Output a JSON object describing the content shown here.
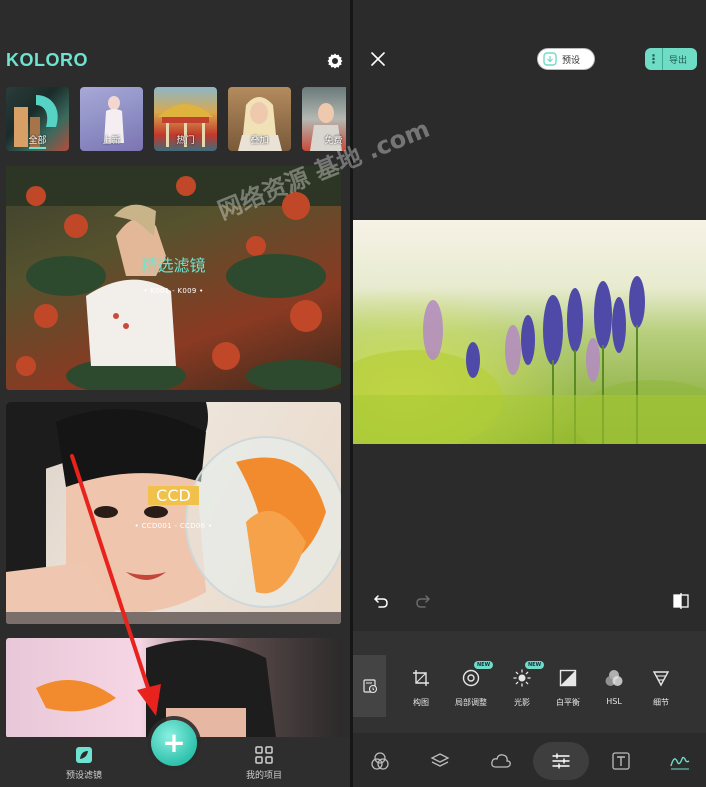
{
  "left": {
    "brand": "KOLORO",
    "categories": [
      {
        "label": "全部",
        "active": true
      },
      {
        "label": "上新",
        "active": false
      },
      {
        "label": "热门",
        "active": false
      },
      {
        "label": "叠加",
        "active": false
      },
      {
        "label": "免费",
        "active": false
      }
    ],
    "cards": [
      {
        "title": "精选滤镜",
        "range": "• K001 - K009 •"
      },
      {
        "title": "CCD",
        "range": "• CCD001 - CCD06 •"
      },
      {
        "title": "",
        "range": ""
      }
    ],
    "bottom_nav": {
      "left_label": "预设滤镜",
      "right_label": "我的项目",
      "fab_symbol": "+"
    }
  },
  "right": {
    "preset_label": "预设",
    "export_label": "导出",
    "tools": [
      {
        "label": "构图",
        "icon": "crop-icon",
        "new": false
      },
      {
        "label": "局部调整",
        "icon": "target-icon",
        "new": true
      },
      {
        "label": "光影",
        "icon": "sun-icon",
        "new": true
      },
      {
        "label": "白平衡",
        "icon": "white-balance-icon",
        "new": false
      },
      {
        "label": "HSL",
        "icon": "hsl-circles-icon",
        "new": false
      },
      {
        "label": "细节",
        "icon": "triangle-detail-icon",
        "new": false
      }
    ],
    "new_badge": "NEW",
    "bottom_tabs": [
      "filter-icon",
      "layers-icon",
      "cloud-icon",
      "sliders-icon",
      "text-icon",
      "signature-icon"
    ]
  },
  "watermark": "网络资源 基地 .com",
  "colors": {
    "accent": "#6ee3cf",
    "background": "#2b2b2b",
    "arrow": "#e8231d",
    "ccd_label_bg": "#f0c14b"
  }
}
